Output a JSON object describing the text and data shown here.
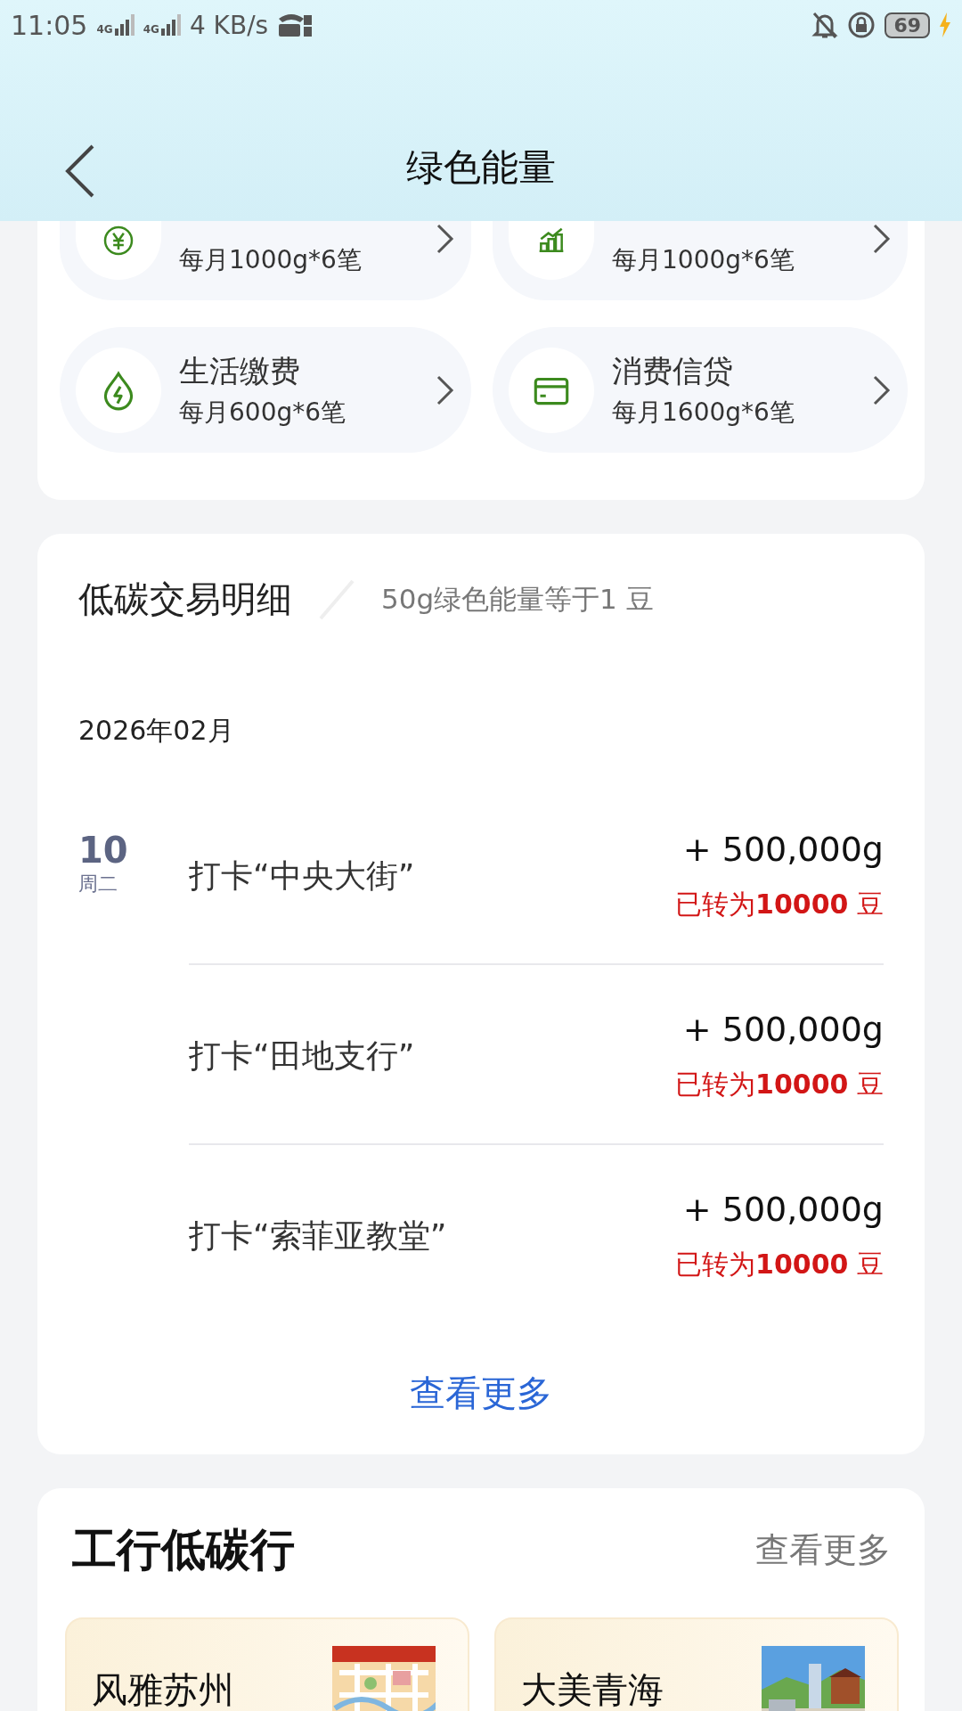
{
  "status_bar": {
    "time": "11:05",
    "signals": [
      {
        "label": "4G"
      },
      {
        "label": "4G"
      }
    ],
    "speed": "4 KB/s",
    "battery": "69"
  },
  "header": {
    "title": "绿色能量"
  },
  "tasks": [
    {
      "subtitle": "每月1000g*6笔"
    },
    {
      "subtitle": "每月1000g*6笔"
    },
    {
      "title": "生活缴费",
      "subtitle": "每月600g*6笔"
    },
    {
      "title": "消费信贷",
      "subtitle": "每月1600g*6笔"
    }
  ],
  "details": {
    "title": "低碳交易明细",
    "note": "50g绿色能量等于1 豆",
    "month": "2026年02月",
    "entries": [
      {
        "day": "10",
        "weekday": "周二",
        "title": "打卡“中央大街”",
        "amount": "+ 500,000g",
        "converted": "已转为**10000** 豆"
      },
      {
        "title": "打卡“田地支行”",
        "amount": "+ 500,000g",
        "converted": "已转为**10000** 豆"
      },
      {
        "title": "打卡“索菲亚教堂”",
        "amount": "+ 500,000g",
        "converted": "已转为**10000** 豆"
      }
    ],
    "more": "查看更多"
  },
  "tours": {
    "title": "工行低碳行",
    "more": "查看更多",
    "items": [
      {
        "title": "风雅苏州",
        "kind": "picture"
      },
      {
        "title": "大美青海",
        "kind": "picture"
      }
    ]
  }
}
